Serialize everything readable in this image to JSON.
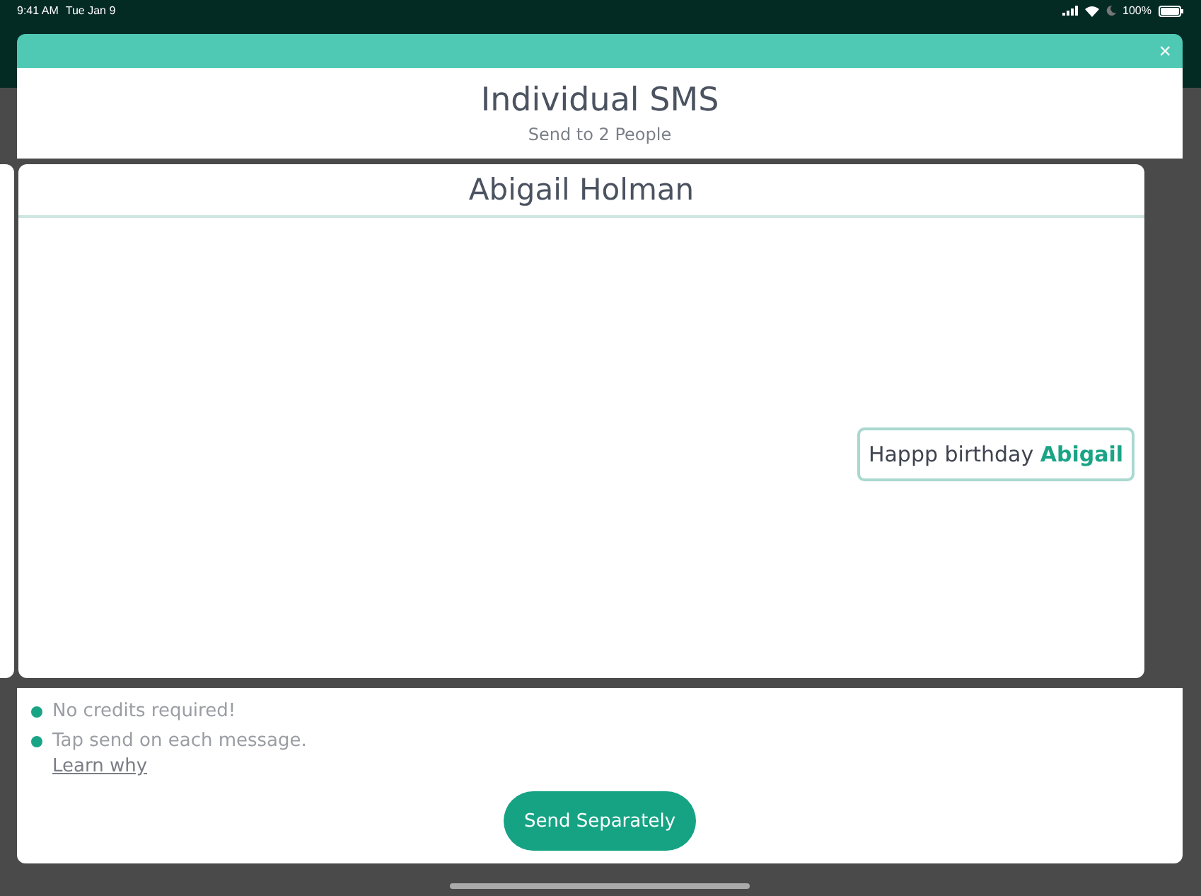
{
  "status_bar": {
    "time": "9:41 AM",
    "date": "Tue Jan 9",
    "battery": "100%"
  },
  "modal": {
    "close": "×",
    "title": "Individual SMS",
    "subtitle": "Send to 2 People"
  },
  "message_card": {
    "recipient": "Abigail Holman",
    "message": "Happp birthday **Abigail**"
  },
  "notes": [
    {
      "text": "No credits required!",
      "color": "#1aa486"
    },
    {
      "text": "Tap send on each message.",
      "color": "#1aa486"
    }
  ],
  "learn_link": "Learn why",
  "send_button": "Send Separately"
}
